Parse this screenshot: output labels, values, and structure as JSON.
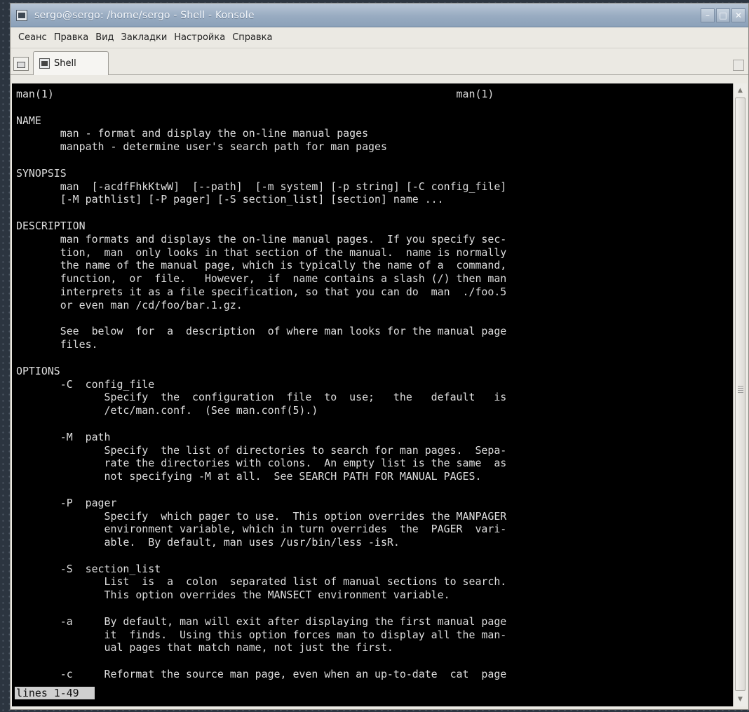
{
  "window": {
    "title": "sergo@sergo: /home/sergo - Shell - Konsole"
  },
  "menu": [
    "Сеанс",
    "Правка",
    "Вид",
    "Закладки",
    "Настройка",
    "Справка"
  ],
  "tabs": [
    {
      "label": "Shell"
    }
  ],
  "terminal": {
    "lines": [
      "man(1)                                                                man(1)",
      "",
      "NAME",
      "       man - format and display the on-line manual pages",
      "       manpath - determine user's search path for man pages",
      "",
      "SYNOPSIS",
      "       man  [-acdfFhkKtwW]  [--path]  [-m system] [-p string] [-C config_file]",
      "       [-M pathlist] [-P pager] [-S section_list] [section] name ...",
      "",
      "DESCRIPTION",
      "       man formats and displays the on-line manual pages.  If you specify sec-",
      "       tion,  man  only looks in that section of the manual.  name is normally",
      "       the name of the manual page, which is typically the name of a  command,",
      "       function,  or  file.   However,  if  name contains a slash (/) then man",
      "       interprets it as a file specification, so that you can do  man  ./foo.5",
      "       or even man /cd/foo/bar.1.gz.",
      "",
      "       See  below  for  a  description  of where man looks for the manual page",
      "       files.",
      "",
      "OPTIONS",
      "       -C  config_file",
      "              Specify  the  configuration  file  to  use;   the   default   is",
      "              /etc/man.conf.  (See man.conf(5).)",
      "",
      "       -M  path",
      "              Specify  the list of directories to search for man pages.  Sepa-",
      "              rate the directories with colons.  An empty list is the same  as",
      "              not specifying -M at all.  See SEARCH PATH FOR MANUAL PAGES.",
      "",
      "       -P  pager",
      "              Specify  which pager to use.  This option overrides the MANPAGER",
      "              environment variable, which in turn overrides  the  PAGER  vari-",
      "              able.  By default, man uses /usr/bin/less -isR.",
      "",
      "       -S  section_list",
      "              List  is  a  colon  separated list of manual sections to search.",
      "              This option overrides the MANSECT environment variable.",
      "",
      "       -a     By default, man will exit after displaying the first manual page",
      "              it  finds.  Using this option forces man to display all the man-",
      "              ual pages that match name, not just the first.",
      "",
      "       -c     Reformat the source man page, even when an up-to-date  cat  page"
    ],
    "status": "lines 1-49"
  },
  "colors": {
    "titlebar": "#98abc1",
    "terminal_bg": "#000000",
    "terminal_fg": "#dedede",
    "status_bg": "#cfcfcf"
  },
  "icons": {
    "window": "terminal-icon",
    "new_tab": "new-tab-icon",
    "tab": "terminal-icon",
    "close_tab": "close-tab-icon",
    "minimize": "minimize-icon",
    "maximize": "maximize-icon",
    "close": "close-icon"
  }
}
